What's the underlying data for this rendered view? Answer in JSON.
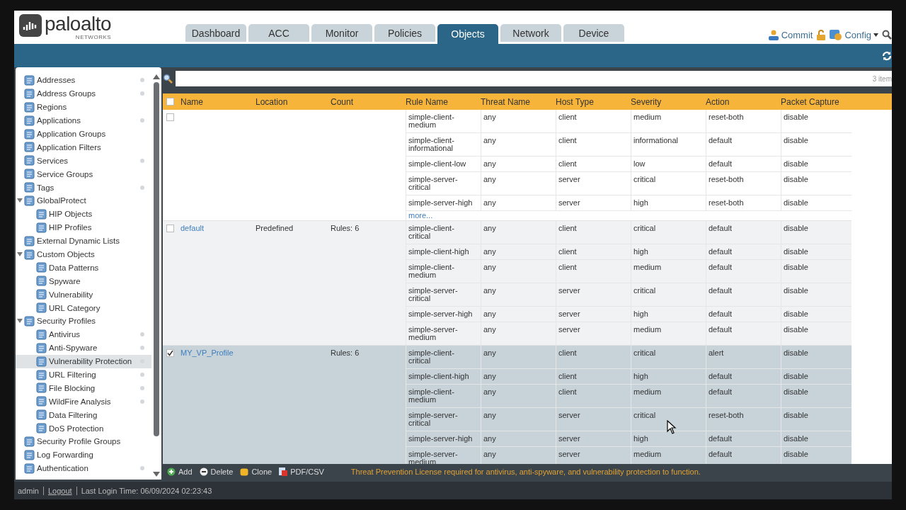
{
  "header": {
    "logo": {
      "brand": "paloalto",
      "sub": "NETWORKS"
    },
    "tabs": [
      {
        "label": "Dashboard",
        "selected": false
      },
      {
        "label": "ACC",
        "selected": false
      },
      {
        "label": "Monitor",
        "selected": false
      },
      {
        "label": "Policies",
        "selected": false
      },
      {
        "label": "Objects",
        "selected": true
      },
      {
        "label": "Network",
        "selected": false
      },
      {
        "label": "Device",
        "selected": false
      }
    ],
    "commit": "Commit",
    "config": "Config"
  },
  "sidebar": {
    "items": [
      {
        "label": "Addresses",
        "dot": true,
        "selected": false
      },
      {
        "label": "Address Groups",
        "dot": true,
        "selected": false
      },
      {
        "label": "Regions",
        "dot": false,
        "selected": false
      },
      {
        "label": "Applications",
        "dot": true,
        "selected": false
      },
      {
        "label": "Application Groups",
        "dot": false,
        "selected": false
      },
      {
        "label": "Application Filters",
        "dot": false,
        "selected": false
      },
      {
        "label": "Services",
        "dot": true,
        "selected": false
      },
      {
        "label": "Service Groups",
        "dot": false,
        "selected": false
      },
      {
        "label": "Tags",
        "dot": true,
        "selected": false
      },
      {
        "label": "GlobalProtect",
        "dot": false,
        "selected": false,
        "expanded": true,
        "children": [
          {
            "label": "HIP Objects",
            "dot": false,
            "selected": false
          },
          {
            "label": "HIP Profiles",
            "dot": false,
            "selected": false
          }
        ]
      },
      {
        "label": "External Dynamic Lists",
        "dot": false,
        "selected": false
      },
      {
        "label": "Custom Objects",
        "dot": false,
        "selected": false,
        "expanded": true,
        "children": [
          {
            "label": "Data Patterns",
            "dot": false,
            "selected": false
          },
          {
            "label": "Spyware",
            "dot": false,
            "selected": false
          },
          {
            "label": "Vulnerability",
            "dot": false,
            "selected": false
          },
          {
            "label": "URL Category",
            "dot": false,
            "selected": false
          }
        ]
      },
      {
        "label": "Security Profiles",
        "dot": false,
        "selected": false,
        "expanded": true,
        "children": [
          {
            "label": "Antivirus",
            "dot": true,
            "selected": false
          },
          {
            "label": "Anti-Spyware",
            "dot": true,
            "selected": false
          },
          {
            "label": "Vulnerability Protection",
            "dot": true,
            "selected": true
          },
          {
            "label": "URL Filtering",
            "dot": true,
            "selected": false
          },
          {
            "label": "File Blocking",
            "dot": true,
            "selected": false
          },
          {
            "label": "WildFire Analysis",
            "dot": true,
            "selected": false
          },
          {
            "label": "Data Filtering",
            "dot": false,
            "selected": false
          },
          {
            "label": "DoS Protection",
            "dot": false,
            "selected": false
          }
        ]
      },
      {
        "label": "Security Profile Groups",
        "dot": false,
        "selected": false
      },
      {
        "label": "Log Forwarding",
        "dot": false,
        "selected": false
      },
      {
        "label": "Authentication",
        "dot": true,
        "selected": false
      }
    ]
  },
  "table": {
    "item_count": "3 item",
    "all_checked": false,
    "columns": [
      "Name",
      "Location",
      "Count",
      "Rule Name",
      "Threat Name",
      "Host Type",
      "Severity",
      "Action",
      "Packet Capture"
    ],
    "profiles": [
      {
        "checked": false,
        "selected": false,
        "more": "more...",
        "rules": [
          {
            "rule_name": "simple-client-medium",
            "threat_name": "any",
            "host_type": "client",
            "severity": "medium",
            "action": "reset-both",
            "packet_capture": "disable"
          },
          {
            "rule_name": "simple-client-informational",
            "threat_name": "any",
            "host_type": "client",
            "severity": "informational",
            "action": "default",
            "packet_capture": "disable"
          },
          {
            "rule_name": "simple-client-low",
            "threat_name": "any",
            "host_type": "client",
            "severity": "low",
            "action": "default",
            "packet_capture": "disable"
          },
          {
            "rule_name": "simple-server-critical",
            "threat_name": "any",
            "host_type": "server",
            "severity": "critical",
            "action": "reset-both",
            "packet_capture": "disable"
          },
          {
            "rule_name": "simple-server-high",
            "threat_name": "any",
            "host_type": "server",
            "severity": "high",
            "action": "reset-both",
            "packet_capture": "disable"
          }
        ]
      },
      {
        "name": "default",
        "location": "Predefined",
        "count": "Rules: 6",
        "checked": false,
        "selected": false,
        "rules": [
          {
            "rule_name": "simple-client-critical",
            "threat_name": "any",
            "host_type": "client",
            "severity": "critical",
            "action": "default",
            "packet_capture": "disable"
          },
          {
            "rule_name": "simple-client-high",
            "threat_name": "any",
            "host_type": "client",
            "severity": "high",
            "action": "default",
            "packet_capture": "disable"
          },
          {
            "rule_name": "simple-client-medium",
            "threat_name": "any",
            "host_type": "client",
            "severity": "medium",
            "action": "default",
            "packet_capture": "disable"
          },
          {
            "rule_name": "simple-server-critical",
            "threat_name": "any",
            "host_type": "server",
            "severity": "critical",
            "action": "default",
            "packet_capture": "disable"
          },
          {
            "rule_name": "simple-server-high",
            "threat_name": "any",
            "host_type": "server",
            "severity": "high",
            "action": "default",
            "packet_capture": "disable"
          },
          {
            "rule_name": "simple-server-medium",
            "threat_name": "any",
            "host_type": "server",
            "severity": "medium",
            "action": "default",
            "packet_capture": "disable"
          }
        ]
      },
      {
        "name": "MY_VP_Profile",
        "count": "Rules: 6",
        "checked": true,
        "selected": true,
        "rules": [
          {
            "rule_name": "simple-client-critical",
            "threat_name": "any",
            "host_type": "client",
            "severity": "critical",
            "action": "alert",
            "packet_capture": "disable"
          },
          {
            "rule_name": "simple-client-high",
            "threat_name": "any",
            "host_type": "client",
            "severity": "high",
            "action": "default",
            "packet_capture": "disable"
          },
          {
            "rule_name": "simple-client-medium",
            "threat_name": "any",
            "host_type": "client",
            "severity": "medium",
            "action": "default",
            "packet_capture": "disable"
          },
          {
            "rule_name": "simple-server-critical",
            "threat_name": "any",
            "host_type": "server",
            "severity": "critical",
            "action": "reset-both",
            "packet_capture": "disable"
          },
          {
            "rule_name": "simple-server-high",
            "threat_name": "any",
            "host_type": "server",
            "severity": "high",
            "action": "default",
            "packet_capture": "disable"
          },
          {
            "rule_name": "simple-server-medium",
            "threat_name": "any",
            "host_type": "server",
            "severity": "medium",
            "action": "default",
            "packet_capture": "disable"
          }
        ]
      }
    ]
  },
  "toolbar": {
    "actions": [
      {
        "kind": "add",
        "label": "Add"
      },
      {
        "kind": "delete",
        "label": "Delete"
      },
      {
        "kind": "clone",
        "label": "Clone"
      },
      {
        "kind": "export",
        "label": "PDF/CSV"
      }
    ],
    "warning": "Threat Prevention License required for antivirus, anti-spyware, and vulnerability protection to function."
  },
  "status_bar": {
    "user": "admin",
    "logout": "Logout",
    "last_login": "Last Login Time: 06/09/2024 02:23:43"
  }
}
